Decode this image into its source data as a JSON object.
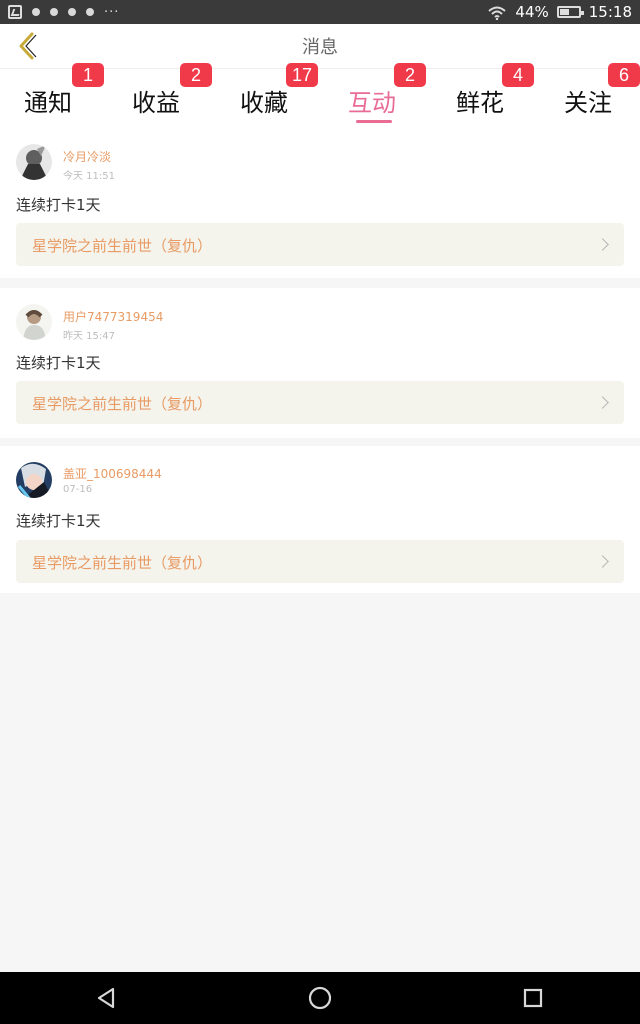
{
  "status_bar": {
    "battery": "44%",
    "time": "15:18",
    "notification_ellipsis": "···"
  },
  "header": {
    "title": "消息"
  },
  "tabs": [
    {
      "label": "通知",
      "badge": "1",
      "active": false
    },
    {
      "label": "收益",
      "badge": "2",
      "active": false
    },
    {
      "label": "收藏",
      "badge": "17",
      "active": false
    },
    {
      "label": "互动",
      "badge": "2",
      "active": true
    },
    {
      "label": "鲜花",
      "badge": "4",
      "active": false
    },
    {
      "label": "关注",
      "badge": "6",
      "active": false
    }
  ],
  "messages": [
    {
      "username": "冷月冷淡",
      "time": "今天 11:51",
      "content": "连续打卡1天",
      "book_title": "星学院之前生前世（复仇）",
      "avatar_icon": "user-avatar-grayscale"
    },
    {
      "username": "用户7477319454",
      "time": "昨天 15:47",
      "content": "连续打卡1天",
      "book_title": "星学院之前生前世（复仇）",
      "avatar_icon": "user-avatar-photo"
    },
    {
      "username": "盖亚_100698444",
      "time": "07-16",
      "content": "连续打卡1天",
      "book_title": "星学院之前生前世（复仇）",
      "avatar_icon": "user-avatar-anime"
    }
  ],
  "colors": {
    "accent": "#e96c95",
    "badge": "#f03a4a",
    "username": "#e89b64",
    "book_link_bg": "#f4f3ec"
  }
}
